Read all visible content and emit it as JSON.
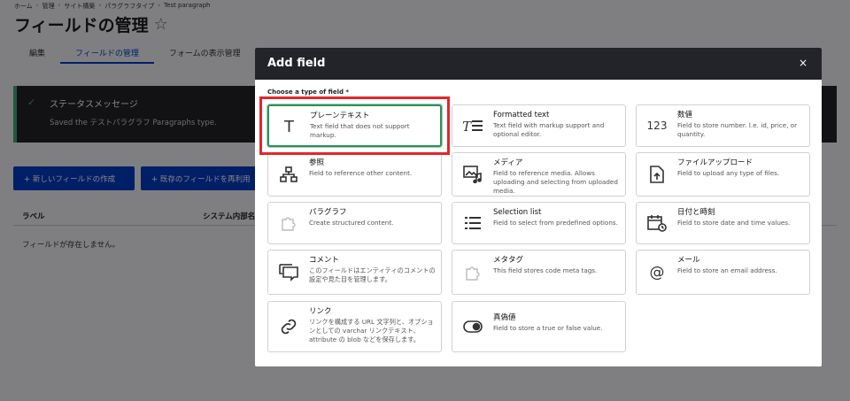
{
  "breadcrumb": [
    "ホーム",
    "管理",
    "サイト構築",
    "パラグラフタイプ",
    "Test paragraph"
  ],
  "page": {
    "title": "フィールドの管理",
    "star": "☆",
    "tabs": [
      "編集",
      "フィールドの管理",
      "フォームの表示管理"
    ],
    "active_tab": 1
  },
  "status": {
    "title": "ステータスメッセージ",
    "message": "Saved the テストパラグラフ Paragraphs type."
  },
  "buttons": {
    "create_field": "+ 新しいフィールドの作成",
    "reuse_field": "+ 既存のフィールドを再利用"
  },
  "table": {
    "col_label": "ラベル",
    "col_system": "システム内部名",
    "empty": "フィールドが存在しません。"
  },
  "modal": {
    "title": "Add field",
    "close": "×",
    "choose_label": "Choose a type of field *",
    "cards": [
      {
        "name": "プレーンテキスト",
        "desc": "Text field that does not support markup.",
        "icon": "text-T-icon"
      },
      {
        "name": "Formatted text",
        "desc": "Text field with markup support and optional editor.",
        "icon": "formatted-text-icon"
      },
      {
        "name": "数値",
        "desc": "Field to store number. I.e. id, price, or quantity.",
        "icon": "number-icon",
        "icon_text": "123"
      },
      {
        "name": "参照",
        "desc": "Field to reference other content.",
        "icon": "hierarchy-icon"
      },
      {
        "name": "メディア",
        "desc": "Field to reference media. Allows uploading and selecting from uploaded media.",
        "icon": "media-icon"
      },
      {
        "name": "ファイルアップロード",
        "desc": "Field to upload any type of files.",
        "icon": "file-upload-icon"
      },
      {
        "name": "パラグラフ",
        "desc": "Create structured content.",
        "icon": "puzzle-icon"
      },
      {
        "name": "Selection list",
        "desc": "Field to select from predefined options.",
        "icon": "list-icon"
      },
      {
        "name": "日付と時刻",
        "desc": "Field to store date and time values.",
        "icon": "calendar-icon"
      },
      {
        "name": "コメント",
        "desc": "このフィールドはエンティティのコメントの設定や見た目を管理します。",
        "icon": "comment-icon"
      },
      {
        "name": "メタタグ",
        "desc": "This field stores code meta tags.",
        "icon": "puzzle-icon"
      },
      {
        "name": "メール",
        "desc": "Field to store an email address.",
        "icon": "at-icon",
        "icon_text": "@"
      },
      {
        "name": "リンク",
        "desc": "リンクを構成する URL 文字列と、オプションとしての varchar リンクテキスト、 attribute の blob などを保存します。",
        "icon": "link-icon"
      },
      {
        "name": "真偽値",
        "desc": "Field to store a true or false value.",
        "icon": "toggle-icon"
      }
    ]
  },
  "colors": {
    "accent": "#003cc5",
    "dark": "#232429",
    "success": "#42a877",
    "selected_border": "#2f8f5b",
    "highlight": "#e3262a"
  }
}
